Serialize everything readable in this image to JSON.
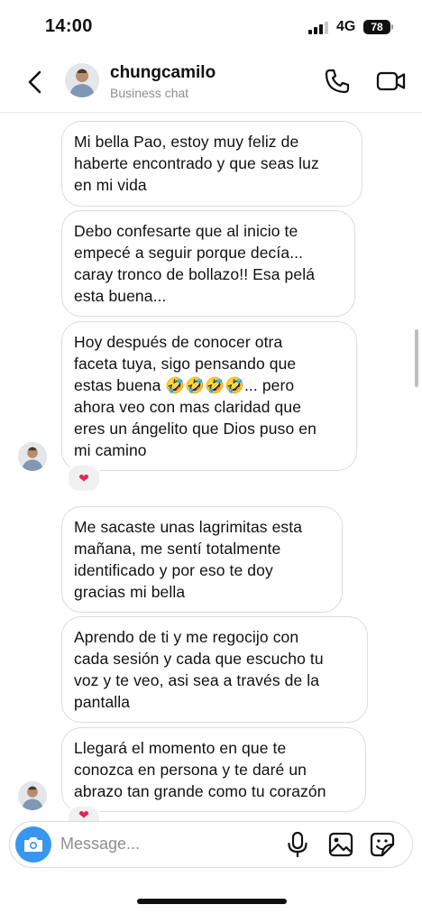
{
  "status_bar": {
    "time": "14:00",
    "network": "4G",
    "battery": "78"
  },
  "header": {
    "name": "chungcamilo",
    "subtitle": "Business chat"
  },
  "messages": [
    {
      "text": "Mi bella Pao, estoy muy feliz de\nhaberte encontrado y que seas luz\nen mi vida"
    },
    {
      "text": "Debo confesarte que al inicio te\nempecé a seguir porque decía...\ncaray tronco de bollazo!! Esa pelá\nesta buena..."
    },
    {
      "text": "Hoy después de conocer otra\nfaceta tuya, sigo pensando que\nestas buena 🤣🤣🤣🤣... pero\nahora veo con mas claridad que\neres un ángelito que Dios puso en\nmi camino",
      "reaction": "❤"
    },
    {
      "text": "Me sacaste unas lagrimitas esta\nmañana, me sentí totalmente\nidentificado y por eso te doy\ngracias mi bella"
    },
    {
      "text": "Aprendo de ti y me regocijo con\ncada sesión y cada que escucho tu\nvoz y te veo, asi sea a través de la\npantalla"
    },
    {
      "text": "Llegará el momento en que te\nconozca en persona y te daré un\nabrazo tan grande como tu corazón",
      "reaction": "❤"
    }
  ],
  "composer": {
    "placeholder": "Message..."
  },
  "icons": {
    "back": "chevron-left-icon",
    "call": "phone-icon",
    "video": "video-camera-icon",
    "camera": "camera-icon",
    "mic": "microphone-icon",
    "gallery": "image-icon",
    "sticker": "sticker-icon"
  },
  "colors": {
    "accent": "#3797f0",
    "bubble_border": "#dcdcdc",
    "subtitle": "#8e8e8e"
  }
}
